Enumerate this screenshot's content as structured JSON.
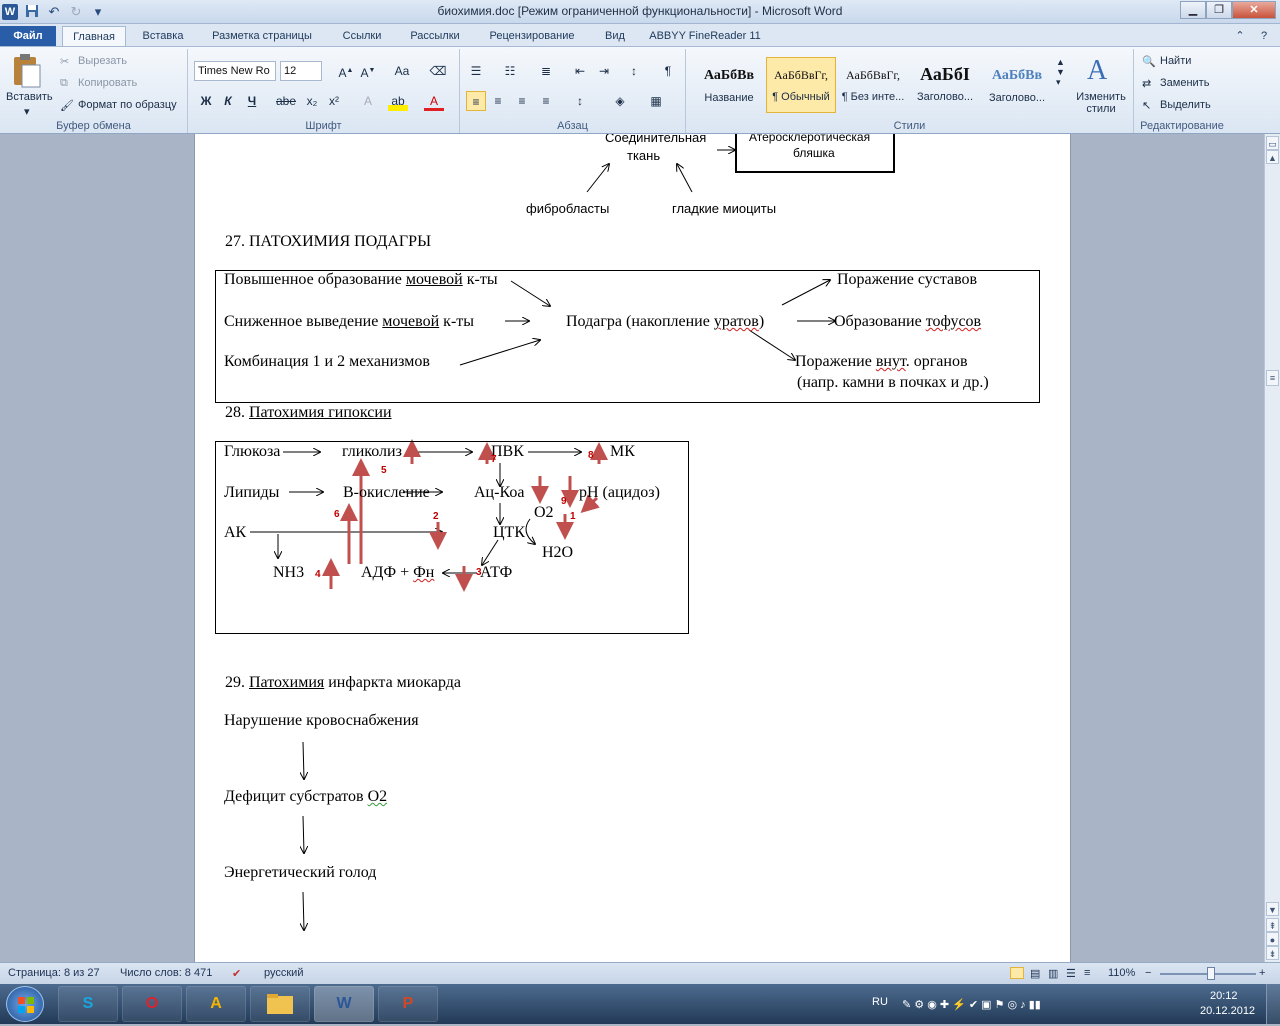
{
  "window": {
    "title": "биохимия.doc [Режим ограниченной функциональности]  -  Microsoft Word",
    "word_logo": "W",
    "undo_icon": "↶",
    "redo_icon": "↻"
  },
  "tabs": [
    "Файл",
    "Главная",
    "Вставка",
    "Разметка страницы",
    "Ссылки",
    "Рассылки",
    "Рецензирование",
    "Вид",
    "ABBYY FineReader 11"
  ],
  "ribbon": {
    "clipboard": {
      "paste": "Вставить",
      "cut": "Вырезать",
      "copy": "Копировать",
      "format_painter": "Формат по образцу",
      "label": "Буфер обмена"
    },
    "font": {
      "name": "Times New Ro",
      "size": "12",
      "label": "Шрифт"
    },
    "paragraph": {
      "label": "Абзац"
    },
    "styles": {
      "items": [
        {
          "preview": "АаБбВв",
          "name": "Название"
        },
        {
          "preview": "АаБбВвГг,",
          "name": "¶ Обычный"
        },
        {
          "preview": "АаБбВвГг,",
          "name": "¶ Без инте..."
        },
        {
          "preview": "АаБбI",
          "name": "Заголово..."
        },
        {
          "preview": "АаБбВв",
          "name": "Заголово..."
        }
      ],
      "change": "Изменить стили",
      "label": "Стили"
    },
    "editing": {
      "find": "Найти",
      "replace": "Заменить",
      "select": "Выделить",
      "label": "Редактирование"
    }
  },
  "doc": {
    "top": {
      "conn_tissue": "Соединительная",
      "tkan": "ткань",
      "plaque1": "Атеросклеротическая",
      "plaque2": "бляшка",
      "fibro": "фибробласты",
      "myo": "гладкие миоциты"
    },
    "s27": {
      "title": "27. ПАТОХИМИЯ ПОДАГРЫ",
      "l1a": "Повышенное образование ",
      "l1b": "мочевой",
      "l1c": " к-ты",
      "l2a": "Сниженное выведение ",
      "l2b": "мочевой",
      "l2c": " к-ты",
      "l3": "Комбинация 1 и 2 механизмов",
      "center_a": "Подагра (накопление ",
      "center_b": "уратов",
      "center_c": ")",
      "r1": "Поражение суставов",
      "r2a": "Образование ",
      "r2b": "тофусов",
      "r3a": "Поражение ",
      "r3b": "внут",
      "r3c": ". органов",
      "r4": "(напр. камни в почках и др.)"
    },
    "s28": {
      "title_num": "28. ",
      "title": "Патохимия гипоксии",
      "glucose": "Глюкоза",
      "glycolysis": "гликолиз",
      "pvk": "ПВК",
      "mk": "МК",
      "lipids": "Липиды",
      "beta": "В-окисление",
      "acoa": "Ац-Коа",
      "ph": "pH (ацидоз)",
      "o2": "О2",
      "ak": "АК",
      "tck": "ЦТК",
      "h2o": "Н2О",
      "nh3": "NH3",
      "adp_a": "АДФ + ",
      "adp_b": "Фн",
      "atf": "АТФ",
      "nums": [
        "1",
        "2",
        "3",
        "4",
        "5",
        "6",
        "7",
        "8",
        "9"
      ]
    },
    "s29": {
      "num": "29. ",
      "title_a": "Патохимия",
      "title_b": " инфаркта миокарда",
      "l1": "Нарушение кровоснабжения",
      "l2a": "Дефицит субстратов ",
      "l2b": "О2",
      "l3": "Энергетический голод"
    }
  },
  "status": {
    "page": "Страница: 8 из 27",
    "words": "Число слов: 8 471",
    "lang": "русский",
    "zoom": "110%",
    "minus": "−",
    "plus": "+"
  },
  "taskbar": {
    "lang": "RU",
    "time": "20:12",
    "date": "20.12.2012",
    "apps": [
      "S",
      "O",
      "A",
      "",
      "W",
      "P"
    ]
  }
}
